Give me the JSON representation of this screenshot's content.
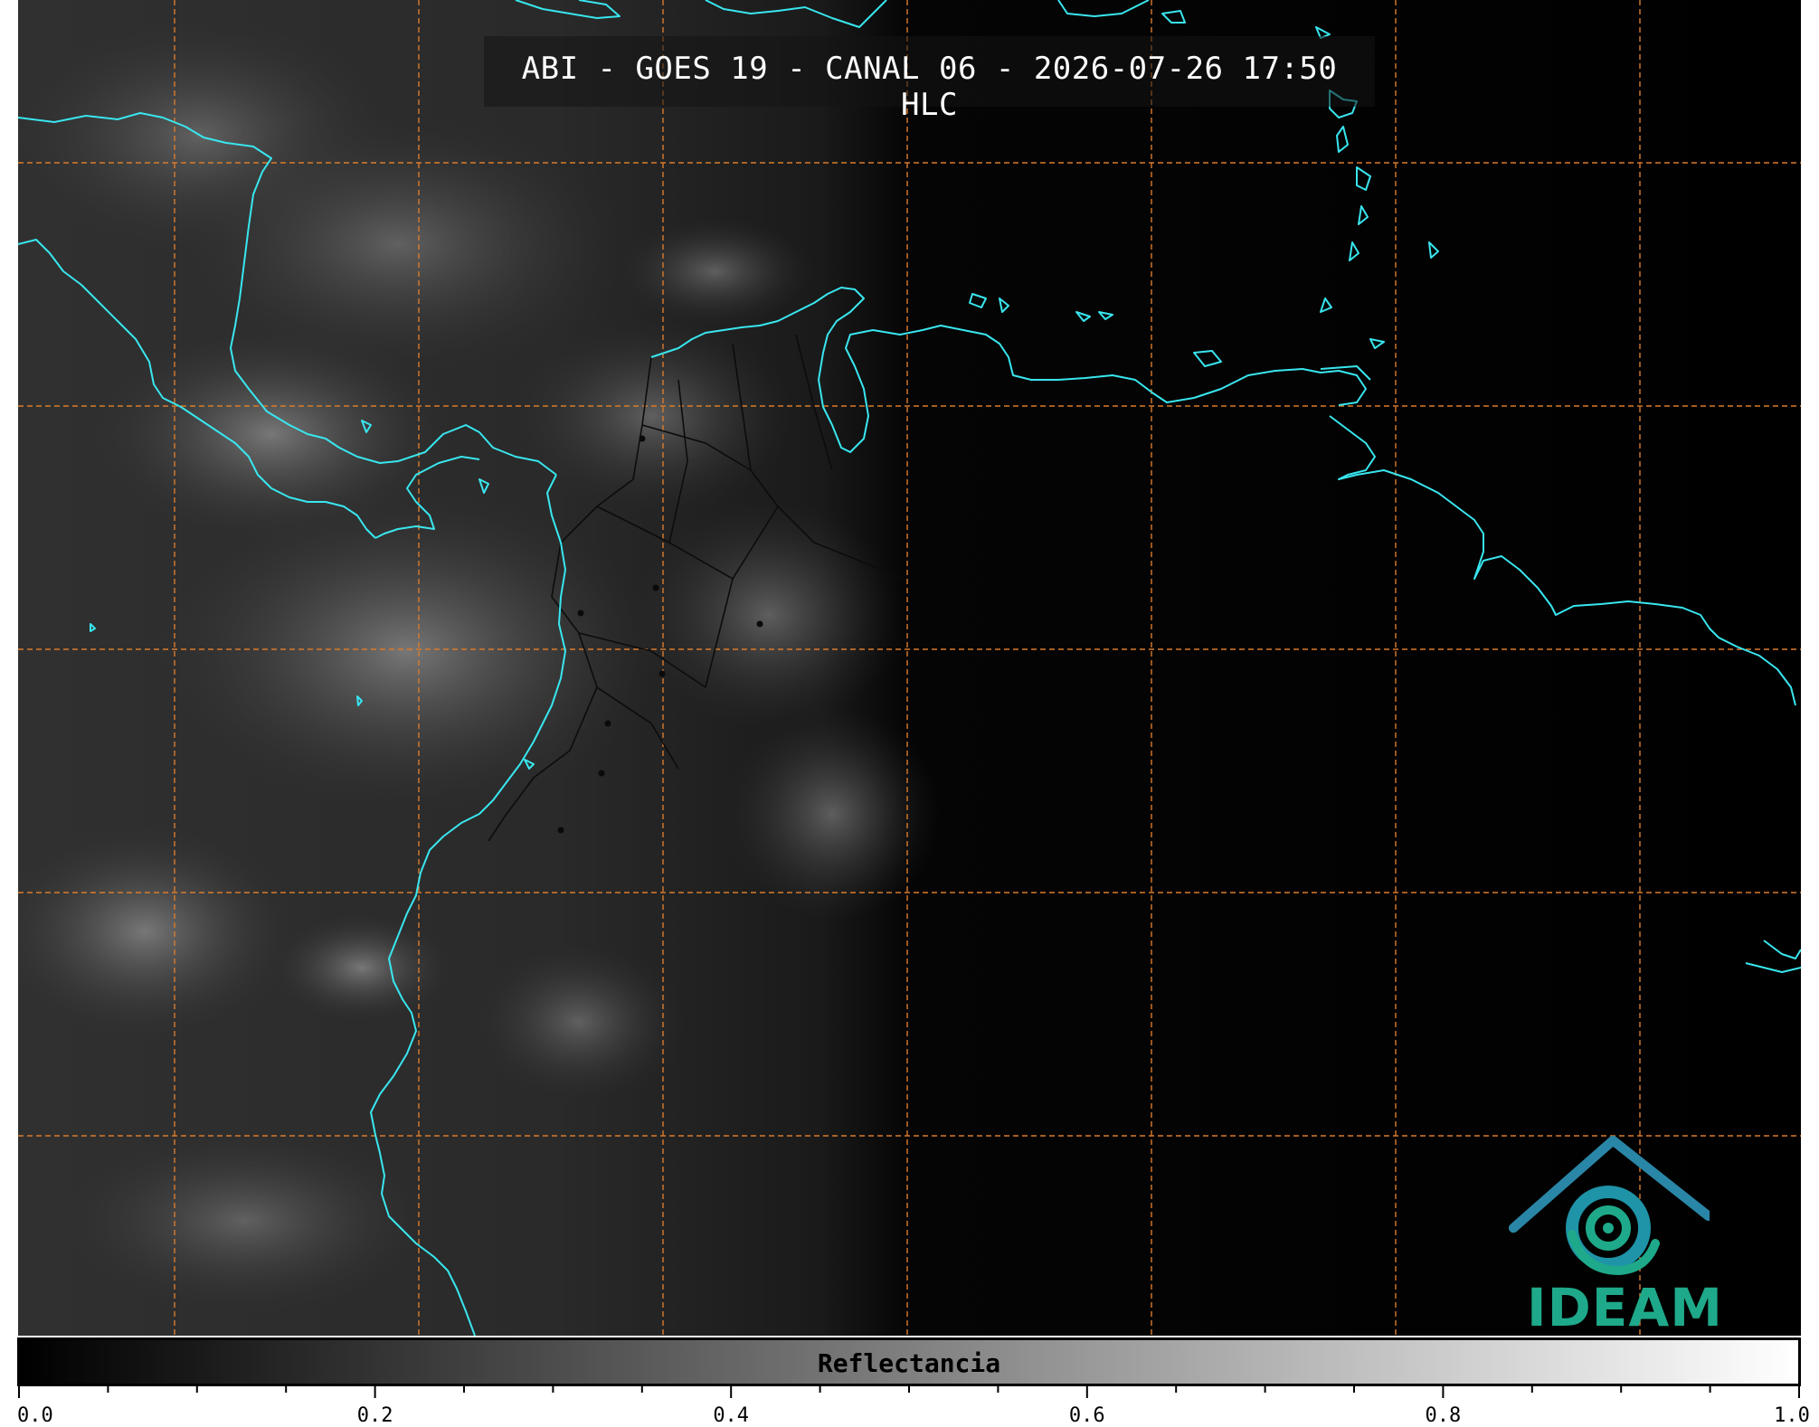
{
  "title": "ABI - GOES 19 - CANAL 06 - 2026-07-26 17:50 HLC",
  "logo": {
    "text": "IDEAM",
    "color": "#1ea98a",
    "icon": "ideam-logo-icon"
  },
  "colorbar": {
    "label": "Reflectancia",
    "ticks": [
      "0.0",
      "0.2",
      "0.4",
      "0.6",
      "0.8",
      "1.0"
    ],
    "range": [
      0.0,
      1.0
    ],
    "colormap": "grayscale"
  },
  "map": {
    "background": "#000000",
    "coastline_color": "#39e6ef",
    "gridline_color": "#d97b2d",
    "border_color": "#111111"
  }
}
